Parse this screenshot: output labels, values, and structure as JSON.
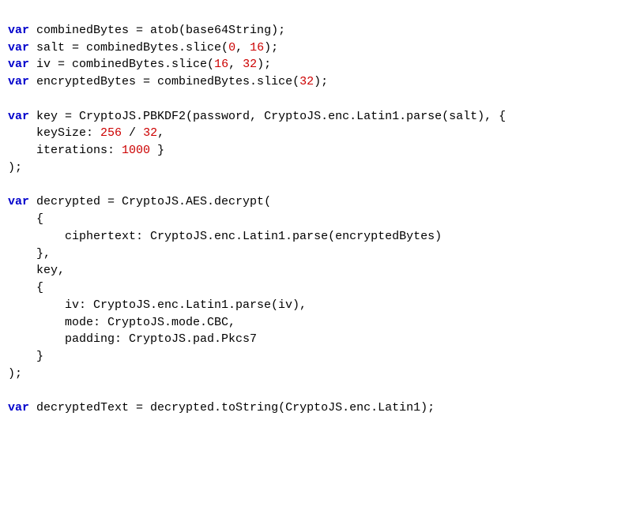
{
  "code": {
    "lines": [
      [
        {
          "t": "var ",
          "c": "kw"
        },
        {
          "t": "combinedBytes = atob(base64String);",
          "c": "pl"
        }
      ],
      [
        {
          "t": "var ",
          "c": "kw"
        },
        {
          "t": "salt = combinedBytes.slice(",
          "c": "pl"
        },
        {
          "t": "0",
          "c": "num"
        },
        {
          "t": ", ",
          "c": "pl"
        },
        {
          "t": "16",
          "c": "num"
        },
        {
          "t": ");",
          "c": "pl"
        }
      ],
      [
        {
          "t": "var ",
          "c": "kw"
        },
        {
          "t": "iv = combinedBytes.slice(",
          "c": "pl"
        },
        {
          "t": "16",
          "c": "num"
        },
        {
          "t": ", ",
          "c": "pl"
        },
        {
          "t": "32",
          "c": "num"
        },
        {
          "t": ");",
          "c": "pl"
        }
      ],
      [
        {
          "t": "var ",
          "c": "kw"
        },
        {
          "t": "encryptedBytes = combinedBytes.slice(",
          "c": "pl"
        },
        {
          "t": "32",
          "c": "num"
        },
        {
          "t": ");",
          "c": "pl"
        }
      ],
      [
        {
          "t": "",
          "c": "pl"
        }
      ],
      [
        {
          "t": "var ",
          "c": "kw"
        },
        {
          "t": "key = CryptoJS.PBKDF2(password, CryptoJS.enc.Latin1.parse(salt), {",
          "c": "pl"
        }
      ],
      [
        {
          "t": "    keySize: ",
          "c": "pl"
        },
        {
          "t": "256",
          "c": "num"
        },
        {
          "t": " / ",
          "c": "pl"
        },
        {
          "t": "32",
          "c": "num"
        },
        {
          "t": ",",
          "c": "pl"
        }
      ],
      [
        {
          "t": "    iterations: ",
          "c": "pl"
        },
        {
          "t": "1000",
          "c": "num"
        },
        {
          "t": " }",
          "c": "pl"
        }
      ],
      [
        {
          "t": ");",
          "c": "pl"
        }
      ],
      [
        {
          "t": "",
          "c": "pl"
        }
      ],
      [
        {
          "t": "var ",
          "c": "kw"
        },
        {
          "t": "decrypted = CryptoJS.AES.decrypt(",
          "c": "pl"
        }
      ],
      [
        {
          "t": "    {",
          "c": "pl"
        }
      ],
      [
        {
          "t": "        ciphertext: CryptoJS.enc.Latin1.parse(encryptedBytes)",
          "c": "pl"
        }
      ],
      [
        {
          "t": "    },",
          "c": "pl"
        }
      ],
      [
        {
          "t": "    key,",
          "c": "pl"
        }
      ],
      [
        {
          "t": "    {",
          "c": "pl"
        }
      ],
      [
        {
          "t": "        iv: CryptoJS.enc.Latin1.parse(iv),",
          "c": "pl"
        }
      ],
      [
        {
          "t": "        mode: CryptoJS.mode.CBC,",
          "c": "pl"
        }
      ],
      [
        {
          "t": "        padding: CryptoJS.pad.Pkcs7",
          "c": "pl"
        }
      ],
      [
        {
          "t": "    }",
          "c": "pl"
        }
      ],
      [
        {
          "t": ");",
          "c": "pl"
        }
      ],
      [
        {
          "t": "",
          "c": "pl"
        }
      ],
      [
        {
          "t": "var ",
          "c": "kw"
        },
        {
          "t": "decryptedText = decrypted.toString(CryptoJS.enc.Latin1);",
          "c": "pl"
        }
      ]
    ]
  }
}
